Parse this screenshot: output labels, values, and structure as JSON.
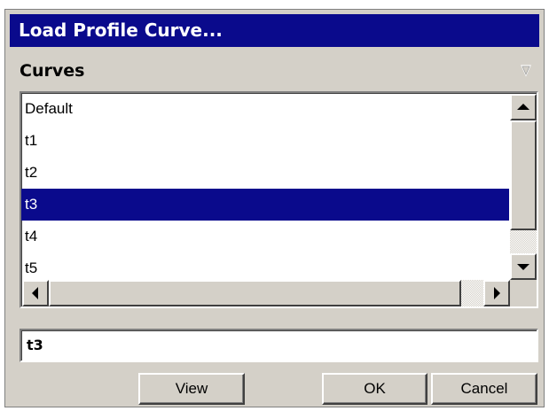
{
  "dialog": {
    "title": "Load Profile Curve..."
  },
  "curves": {
    "label": "Curves",
    "items": [
      {
        "label": "Default",
        "selected": false
      },
      {
        "label": "t1",
        "selected": false
      },
      {
        "label": "t2",
        "selected": false
      },
      {
        "label": "t3",
        "selected": true
      },
      {
        "label": "t4",
        "selected": false
      },
      {
        "label": "t5",
        "selected": false
      }
    ]
  },
  "selection_field": {
    "value": "t3"
  },
  "buttons": {
    "view": "View",
    "ok": "OK",
    "cancel": "Cancel"
  },
  "colors": {
    "title_bar": "#0a0a8c",
    "selection": "#0a0a8c",
    "face": "#d4d0c8"
  },
  "icons": {
    "collapse": "triangle-down-icon",
    "scroll_up": "arrow-up-icon",
    "scroll_down": "arrow-down-icon",
    "scroll_left": "arrow-left-icon",
    "scroll_right": "arrow-right-icon"
  }
}
